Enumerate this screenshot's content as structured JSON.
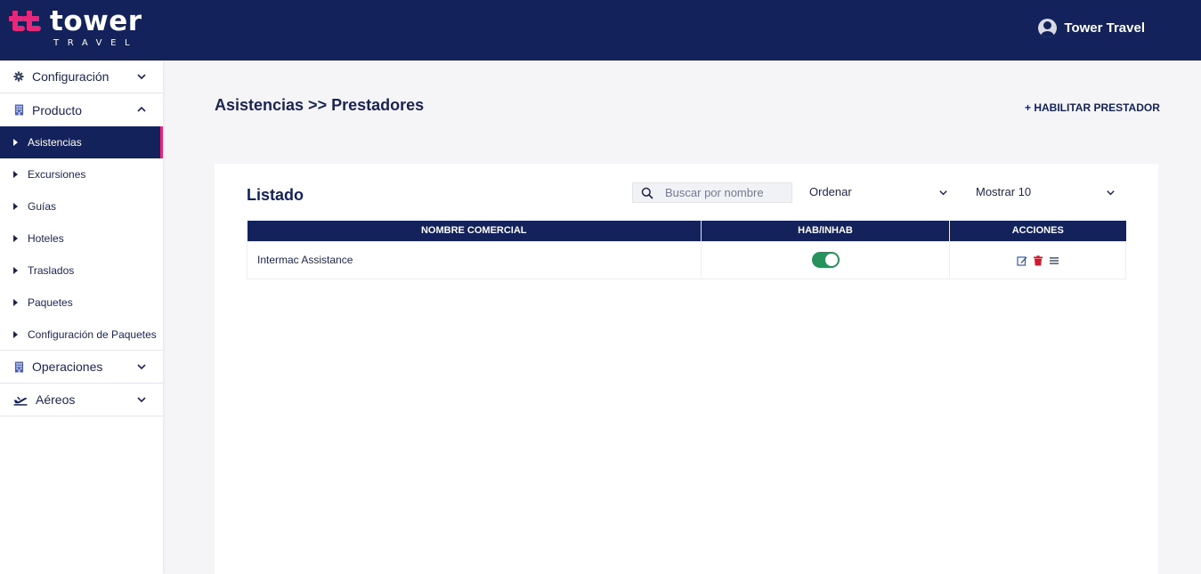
{
  "header": {
    "logo_word": "tower",
    "logo_sub": "TRAVEL",
    "user_name": "Tower Travel"
  },
  "sidebar": {
    "groups": [
      {
        "label": "Configuración",
        "icon": "gear-icon"
      },
      {
        "label": "Producto",
        "icon": "building-icon",
        "expanded": true,
        "items": [
          "Asistencias",
          "Excursiones",
          "Guías",
          "Hoteles",
          "Traslados",
          "Paquetes",
          "Configuración de Paquetes"
        ]
      },
      {
        "label": "Operaciones",
        "icon": "building-icon"
      },
      {
        "label": "Aéreos",
        "icon": "plane-icon"
      }
    ],
    "active_item": "Asistencias"
  },
  "main": {
    "title": "Asistencias >> Prestadores",
    "enable_button": "+ HABILITAR PRESTADOR",
    "list": {
      "title": "Listado",
      "search_placeholder": "Buscar por nombre",
      "order_label": "Ordenar",
      "show_label": "Mostrar 10",
      "columns": [
        "NOMBRE COMERCIAL",
        "HAB/INHAB",
        "ACCIONES"
      ],
      "rows": [
        {
          "name": "Intermac Assistance",
          "enabled": true
        }
      ]
    }
  },
  "colors": {
    "navy": "#13225a",
    "accent_pink": "#e5287a",
    "toggle_on": "#27925b",
    "delete_red": "#d0192c"
  }
}
